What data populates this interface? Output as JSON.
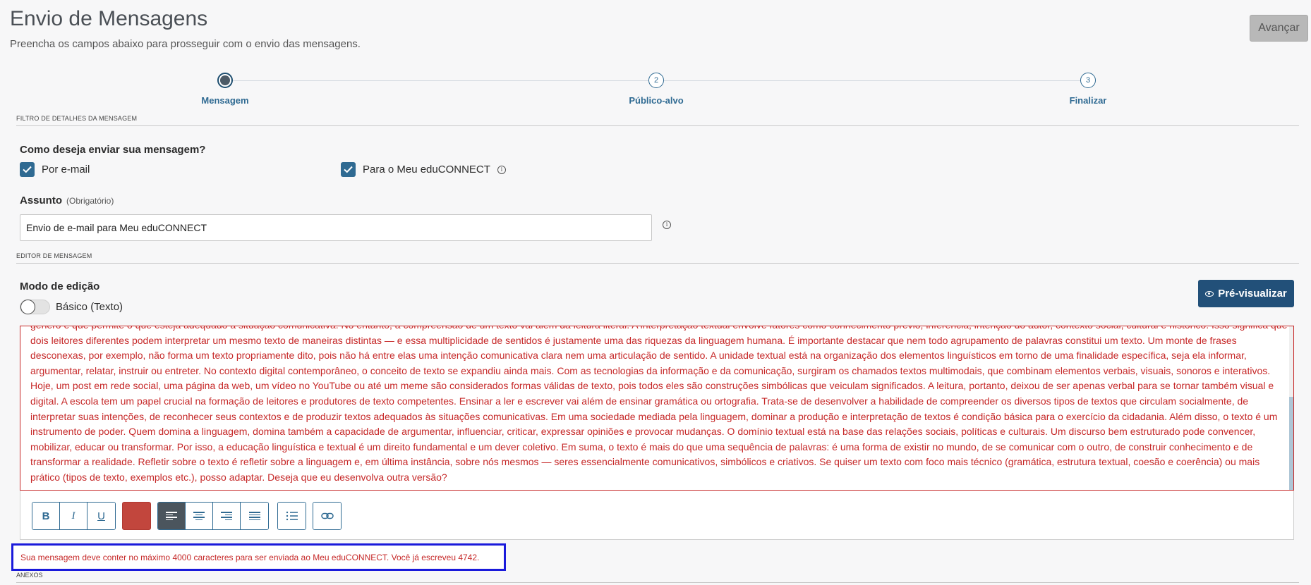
{
  "header": {
    "title": "Envio de Mensagens",
    "subtitle": "Preencha os campos abaixo para prosseguir com o envio das mensagens.",
    "next_button": "Avançar"
  },
  "stepper": {
    "steps": [
      {
        "number": "",
        "label": "Mensagem",
        "active": true
      },
      {
        "number": "2",
        "label": "Público-alvo",
        "active": false
      },
      {
        "number": "3",
        "label": "Finalizar",
        "active": false
      }
    ]
  },
  "filter_section": {
    "label": "FILTRO DE DETALHES DA MENSAGEM",
    "question": "Como deseja enviar sua mensagem?",
    "options": [
      {
        "label": "Por e-mail",
        "checked": true
      },
      {
        "label": "Para o Meu eduCONNECT",
        "checked": true
      }
    ],
    "info_glyph": "i",
    "subject_label": "Assunto",
    "subject_required": "(Obrigatório)",
    "subject_value": "Envio de e-mail para Meu eduCONNECT"
  },
  "editor_section": {
    "label": "EDITOR DE MENSAGEM",
    "mode_label": "Modo de edição",
    "toggle_label": "Básico (Texto)",
    "preview_button": "Pré-visualizar",
    "body_text": "gênero e que permite o que esteja adequado à situação comunicativa. No entanto, a compreensão de um texto vai além da leitura literal. A interpretação textual envolve fatores como conhecimento prévio, inferência, intenção do autor, contexto social, cultural e histórico. Isso significa que dois leitores diferentes podem interpretar um mesmo texto de maneiras distintas — e essa multiplicidade de sentidos é justamente uma das riquezas da linguagem humana. É importante destacar que nem todo agrupamento de palavras constitui um texto. Um monte de frases desconexas, por exemplo, não forma um texto propriamente dito, pois não há entre elas uma intenção comunicativa clara nem uma articulação de sentido. A unidade textual está na organização dos elementos linguísticos em torno de uma finalidade específica, seja ela informar, argumentar, relatar, instruir ou entreter. No contexto digital contemporâneo, o conceito de texto se expandiu ainda mais. Com as tecnologias da informação e da comunicação, surgiram os chamados textos multimodais, que combinam elementos verbais, visuais, sonoros e interativos. Hoje, um post em rede social, uma página da web, um vídeo no YouTube ou até um meme são considerados formas válidas de texto, pois todos eles são construções simbólicas que veiculam significados. A leitura, portanto, deixou de ser apenas verbal para se tornar também visual e digital. A escola tem um papel crucial na formação de leitores e produtores de texto competentes. Ensinar a ler e escrever vai além de ensinar gramática ou ortografia. Trata-se de desenvolver a habilidade de compreender os diversos tipos de textos que circulam socialmente, de interpretar suas intenções, de reconhecer seus contextos e de produzir textos adequados às situações comunicativas. Em uma sociedade mediada pela linguagem, dominar a produção e interpretação de textos é condição básica para o exercício da cidadania. Além disso, o texto é um instrumento de poder. Quem domina a linguagem, domina também a capacidade de argumentar, influenciar, criticar, expressar opiniões e provocar mudanças. O domínio textual está na base das relações sociais, políticas e culturais. Um discurso bem estruturado pode convencer, mobilizar, educar ou transformar. Por isso, a educação linguística e textual é um direito fundamental e um dever coletivo. Em suma, o texto é mais do que uma sequência de palavras: é uma forma de existir no mundo, de se comunicar com o outro, de construir conhecimento e de transformar a realidade. Refletir sobre o texto é refletir sobre a linguagem e, em última instância, sobre nós mesmos — seres essencialmente comunicativos, simbólicos e criativos. Se quiser um texto com foco mais técnico (gramática, estrutura textual, coesão e coerência) ou mais prático (tipos de texto, exemplos etc.), posso adaptar. Deseja que eu desenvolva outra versão?",
    "toolbar": {
      "bold": "B",
      "italic": "I",
      "underline": "U",
      "text_color": "#c2463d"
    },
    "warning": "Sua mensagem deve conter no máximo 4000 caracteres para ser enviada ao Meu eduCONNECT. Você já escreveu 4742."
  },
  "attachments_section": {
    "label": "ANEXOS"
  },
  "colors": {
    "primary": "#2f6a92",
    "preview_button": "#225079",
    "error": "#c62828",
    "highlight_border": "#1a1adb"
  }
}
